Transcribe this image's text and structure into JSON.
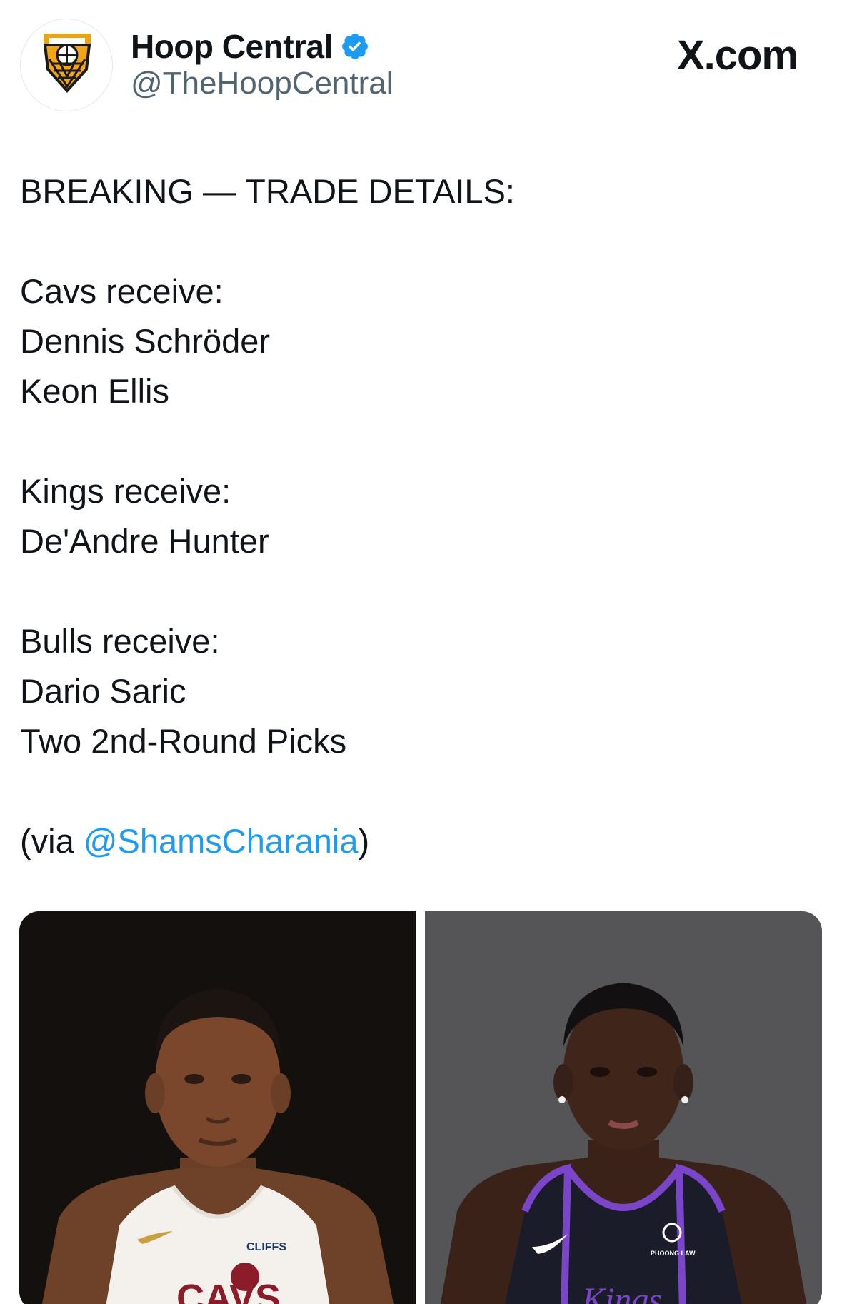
{
  "account": {
    "display_name": "Hoop Central",
    "handle": "@TheHoopCentral",
    "verified": true,
    "avatar_icon": "basketball-hoop-shield-logo-icon"
  },
  "site": {
    "logo_label": "X.com"
  },
  "tweet": {
    "headline": "BREAKING — TRADE DETAILS:",
    "groups": [
      {
        "title": "Cavs receive:",
        "items": [
          "Dennis Schröder",
          "Keon Ellis"
        ]
      },
      {
        "title": "Kings receive:",
        "items": [
          "De'Andre Hunter"
        ]
      },
      {
        "title": "Bulls receive:",
        "items": [
          "Dario Saric",
          "Two 2nd-Round Picks"
        ]
      }
    ],
    "via_prefix": "(via ",
    "via_mention": "@ShamsCharania",
    "via_suffix": ")"
  },
  "media": {
    "photos": [
      {
        "alt_icon": "player-photo-cavaliers",
        "jersey_sponsor": "CLIFFS",
        "jersey_text": "CAVS"
      },
      {
        "alt_icon": "player-photo-kings",
        "jersey_sponsor": "PHOONG LAW"
      }
    ]
  },
  "colors": {
    "text": "#0f1419",
    "secondary": "#536471",
    "link": "#1d9bf0",
    "verified_badge": "#1d9bf0"
  }
}
